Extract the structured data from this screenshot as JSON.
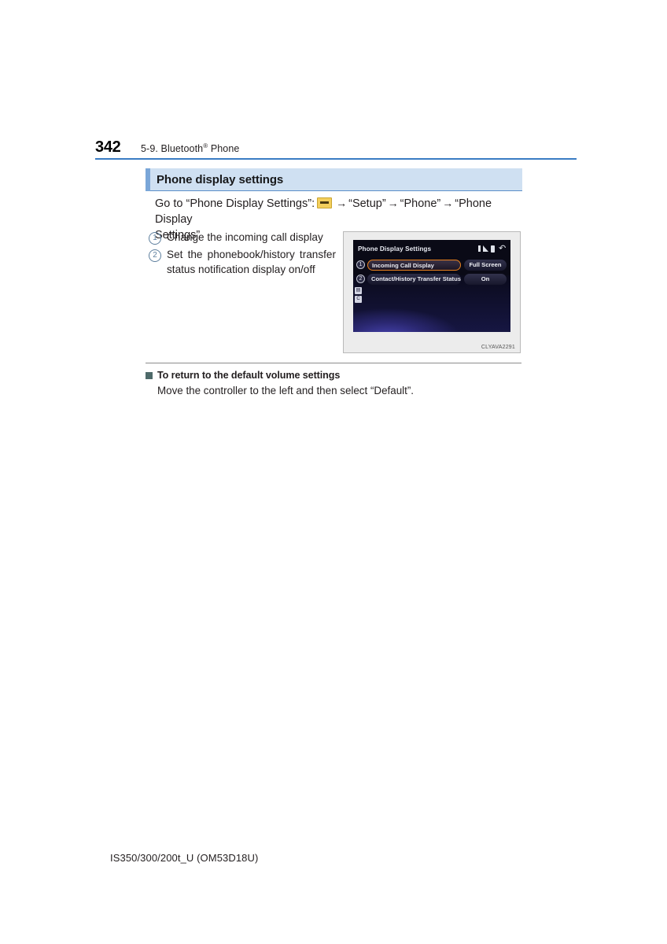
{
  "header": {
    "page_number": "342",
    "chapter_prefix": "5-9. Bluetooth",
    "chapter_registered_mark": "®",
    "chapter_suffix": "Phone"
  },
  "section": {
    "title": "Phone display settings"
  },
  "goto": {
    "lead": "Go to “Phone Display Settings”:",
    "menu_icon": "menu-button-icon",
    "arrow_1": "→",
    "step_1": "“Setup”",
    "arrow_2": "→",
    "step_2": "“Phone”",
    "arrow_3": "→",
    "step_3": "“Phone Display",
    "step_3_cont": "Settings”"
  },
  "callouts": [
    {
      "number": "①",
      "num_text": "1",
      "text": "Change the incoming call display"
    },
    {
      "number": "②",
      "num_text": "2",
      "text": "Set the phonebook/history transfer status notification display on/off"
    }
  ],
  "figure": {
    "code": "CLYAVA2291",
    "screen": {
      "title": "Phone Display Settings",
      "status_icons": [
        "battery-icon",
        "signal-icon",
        "phone-icon",
        "back-icon"
      ],
      "rows": [
        {
          "badge": "1",
          "label": "Incoming Call Display",
          "value": "Full Screen",
          "selected": true
        },
        {
          "badge": "2",
          "label": "Contact/History Transfer Status",
          "value": "On",
          "selected": false
        }
      ],
      "side_tabs": [
        "▤",
        "C"
      ]
    }
  },
  "note": {
    "heading": "To return to the default volume settings",
    "body": "Move the controller to the left and then select “Default”."
  },
  "footer": {
    "text": "IS350/300/200t_U (OM53D18U)"
  },
  "colors": {
    "rule_blue": "#3a7cc4",
    "section_bg": "#cfe0f2",
    "section_accent": "#7aa6d8",
    "callout_circle": "#5e7f9e",
    "note_bullet": "#4e6a6a",
    "selection_orange": "#e8801e"
  }
}
